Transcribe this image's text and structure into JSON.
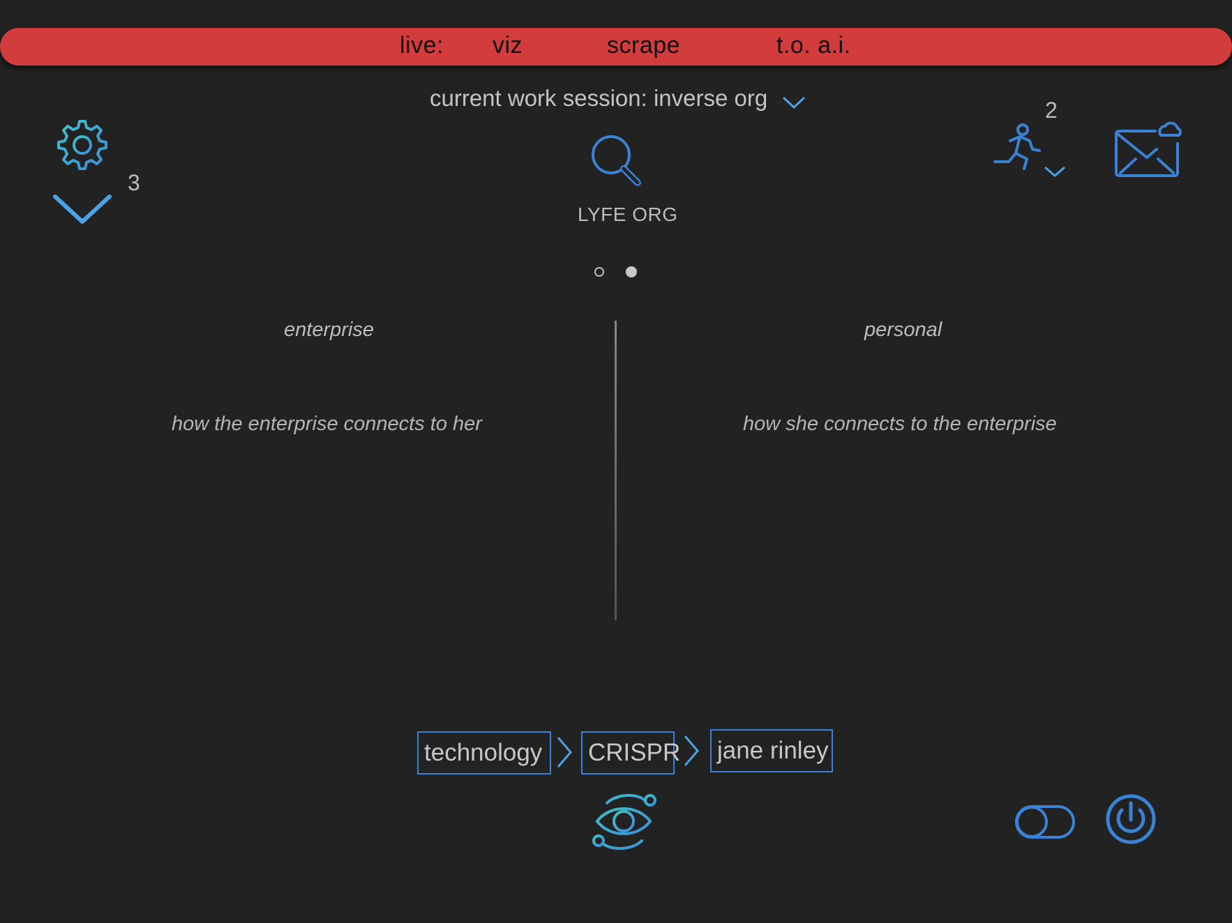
{
  "topbar": {
    "live_label": "live:",
    "tabs": [
      "viz",
      "scrape",
      "t.o. a.i."
    ]
  },
  "session": {
    "label": "current work session: inverse org"
  },
  "left_controls": {
    "collapse_count": "3"
  },
  "right_controls": {
    "activity_count": "2"
  },
  "search": {
    "org_name": "LYFE ORG"
  },
  "pager": {
    "pages": 2,
    "active": 2
  },
  "columns": {
    "left": {
      "heading": "enterprise",
      "description": "how the enterprise connects to her"
    },
    "right": {
      "heading": "personal",
      "description": "how she connects to the enterprise"
    }
  },
  "breadcrumb": [
    "technology",
    "CRISPR",
    "jane rinley"
  ],
  "icons": {
    "settings": "gear-icon",
    "collapse": "chevron-down-icon",
    "search": "search-icon",
    "activity": "running-person-icon",
    "mail": "mail-cloud-icon",
    "vision": "eye-orbit-icon",
    "toggle": "toggle-icon",
    "power": "power-icon"
  },
  "colors": {
    "background": "#222222",
    "topbar": "#d33c3c",
    "accent_blue": "#3a82d6",
    "accent_teal": "#3fb4c8",
    "text": "#c4c4c4"
  }
}
